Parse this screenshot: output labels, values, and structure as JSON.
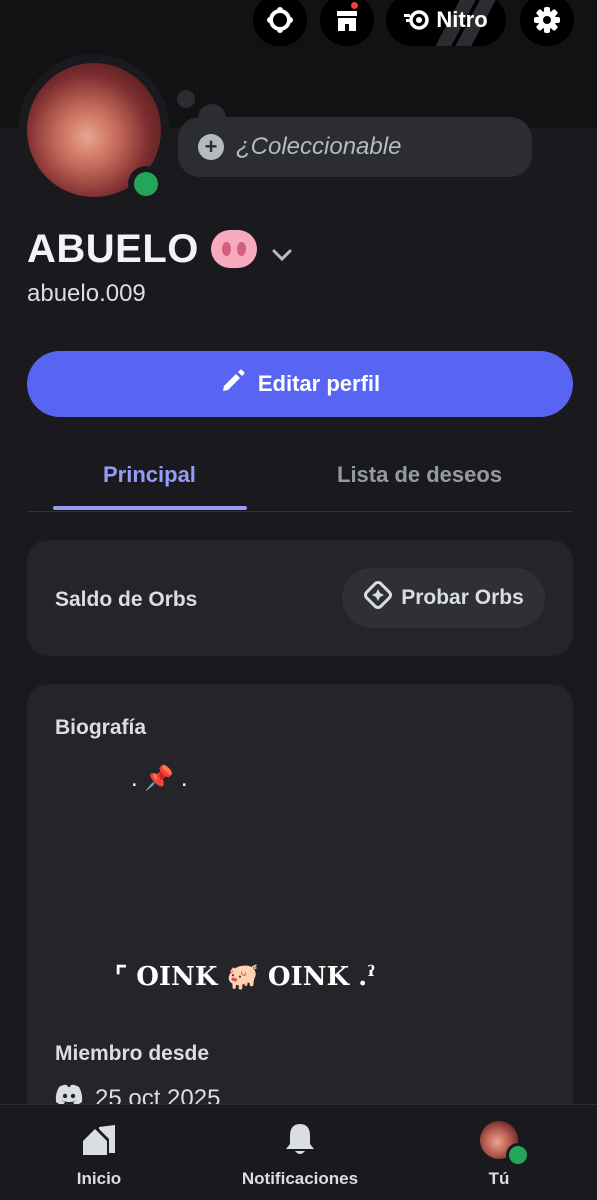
{
  "header": {
    "nitro_label": "Nitro"
  },
  "profile": {
    "display_name": "ABUELO",
    "username": "abuelo.009",
    "collectible_placeholder": "¿Coleccionable",
    "status": "online"
  },
  "actions": {
    "edit_profile_label": "Editar perfil"
  },
  "tabs": [
    {
      "label": "Principal",
      "active": true
    },
    {
      "label": "Lista de deseos",
      "active": false
    }
  ],
  "orbs": {
    "label": "Saldo de Orbs",
    "button_label": "Probar Orbs"
  },
  "bio": {
    "title": "Biografía",
    "line1": ". 📌 .",
    "line2": "⌜ OINK 🐖 OINK .ˀ",
    "member_since_title": "Miembro desde",
    "member_since_date": "25 oct 2025"
  },
  "bottom_nav": [
    {
      "label": "Inicio",
      "icon": "home-icon"
    },
    {
      "label": "Notificaciones",
      "icon": "bell-icon"
    },
    {
      "label": "Tú",
      "icon": "avatar"
    }
  ],
  "colors": {
    "accent": "#5865f2",
    "tab_active": "#949cf7",
    "online": "#23a55a",
    "badge": "#f23f43"
  }
}
